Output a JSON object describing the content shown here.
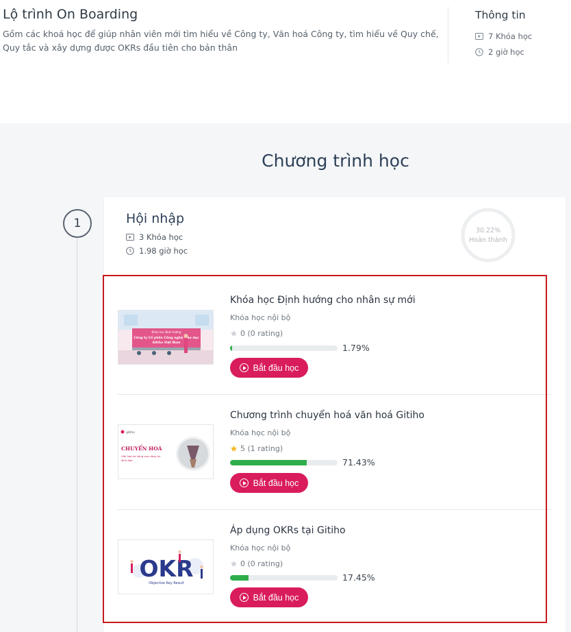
{
  "header": {
    "title": "Lộ trình On Boarding",
    "description": "Gồm các khoá học để giúp nhân viên mới tìm hiểu về Công ty, Văn hoá Công ty, tìm hiểu về Quy chế, Quy tắc và xây dựng được OKRs đầu tiên cho bản thân",
    "info": {
      "title": "Thông tin",
      "courses": "7 Khóa học",
      "hours": "2 giờ học"
    }
  },
  "program": {
    "title": "Chương trình học",
    "step_number": "1",
    "module": {
      "title": "Hội nhập",
      "courses": "3 Khóa học",
      "hours": "1.98 giờ học",
      "progress_percent": "30.22%",
      "progress_label": "Hoàn thành",
      "progress_value": 30.22
    },
    "courses": [
      {
        "title": "Khóa học Định hướng cho nhân sự mới",
        "subtitle": "Khóa học nội bộ",
        "rating": "0 (0 rating)",
        "rated": false,
        "progress_text": "1.79%",
        "progress_value": 1.79,
        "button": "Bắt đầu học",
        "thumb": {
          "line1": "Khóa học Định hướng",
          "line2": "Công ty Cổ phần Công nghệ giáo dục",
          "line3": "Gitiho Việt Nam"
        }
      },
      {
        "title": "Chương trình chuyển hoá văn hoá Gitiho",
        "subtitle": "Khóa học nội bộ",
        "rating": "5 (1 rating)",
        "rated": true,
        "progress_text": "71.43%",
        "progress_value": 71.43,
        "button": "Bắt đầu học",
        "thumb": {
          "brand": "gitiho",
          "line1": "CHUYỂN HOÁ",
          "line2": "Văn hoá và năng cao năng lực",
          "line3": "lãnh đạo"
        }
      },
      {
        "title": "Áp dụng OKRs tại Gitiho",
        "subtitle": "Khóa học nội bộ",
        "rating": "0 (0 rating)",
        "rated": false,
        "progress_text": "17.45%",
        "progress_value": 17.45,
        "button": "Bắt đầu học",
        "thumb": {
          "line1": "OKR",
          "line2": "Objective Key Result"
        }
      }
    ]
  },
  "colors": {
    "accent": "#d91c5c",
    "progress": "#2eae4b",
    "highlight": "#c8181e",
    "star_on": "#f4b92c",
    "star_off": "#cfd3d7"
  }
}
